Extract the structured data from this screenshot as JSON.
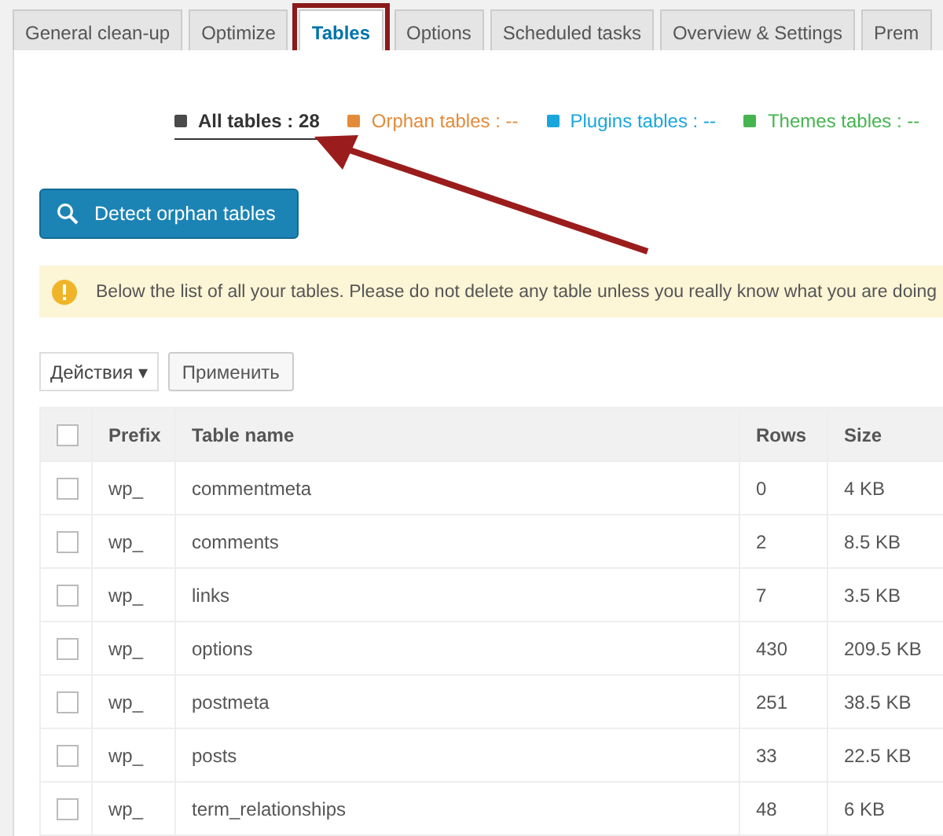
{
  "tabs": [
    {
      "label": "General clean-up",
      "selected": false
    },
    {
      "label": "Optimize",
      "selected": false
    },
    {
      "label": "Tables",
      "selected": true
    },
    {
      "label": "Options",
      "selected": false
    },
    {
      "label": "Scheduled tasks",
      "selected": false
    },
    {
      "label": "Overview & Settings",
      "selected": false
    },
    {
      "label": "Prem",
      "selected": false
    }
  ],
  "filters": [
    {
      "label": "All tables : 28",
      "color": "#4a4a4a",
      "selected": true
    },
    {
      "label": "Orphan tables : --",
      "color": "#e38b3a",
      "selected": false
    },
    {
      "label": "Plugins tables : --",
      "color": "#1aa6dc",
      "selected": false
    },
    {
      "label": "Themes tables : --",
      "color": "#46b450",
      "selected": false
    }
  ],
  "detect_button": {
    "label": "Detect orphan tables"
  },
  "notice": {
    "text": "Below the list of all your tables. Please do not delete any table unless you really know what you are doing"
  },
  "bulk_actions": {
    "dropdown": "Действия ▾",
    "apply": "Применить"
  },
  "table": {
    "header_checked": false,
    "columns": [
      "Prefix",
      "Table name",
      "Rows",
      "Size"
    ],
    "rows": [
      {
        "checked": false,
        "cells": [
          "wp_",
          "commentmeta",
          "0",
          "4 KB"
        ]
      },
      {
        "checked": false,
        "cells": [
          "wp_",
          "comments",
          "2",
          "8.5 KB"
        ]
      },
      {
        "checked": false,
        "cells": [
          "wp_",
          "links",
          "7",
          "3.5 KB"
        ]
      },
      {
        "checked": false,
        "cells": [
          "wp_",
          "options",
          "430",
          "209.5 KB"
        ]
      },
      {
        "checked": false,
        "cells": [
          "wp_",
          "postmeta",
          "251",
          "38.5 KB"
        ]
      },
      {
        "checked": false,
        "cells": [
          "wp_",
          "posts",
          "33",
          "22.5 KB"
        ]
      },
      {
        "checked": false,
        "cells": [
          "wp_",
          "term_relationships",
          "48",
          "6 KB"
        ]
      }
    ]
  }
}
